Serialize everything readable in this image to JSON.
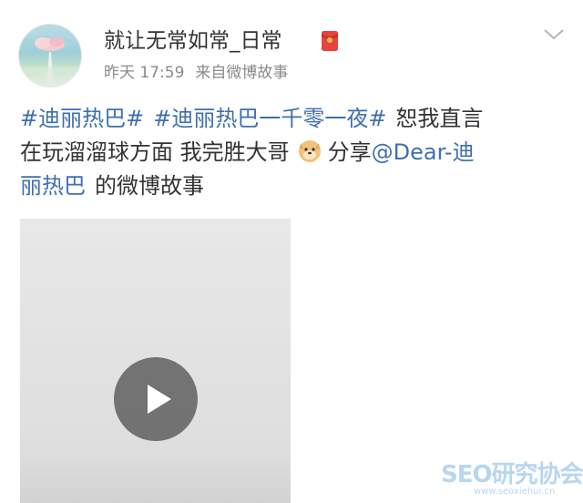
{
  "post": {
    "username": "就让无常如常_日常",
    "time": "昨天 17:59",
    "source": "来自微博故事",
    "text": {
      "topic1": "#迪丽热巴#",
      "topic2": "#迪丽热巴一千零一夜#",
      "line1_tail": "恕我直言",
      "line2_text": "在玩溜溜球方面 我完胜大哥",
      "share_label": "分享",
      "mention_part1": "@Dear-迪",
      "mention_part2": "丽热巴",
      "line3_tail": "的微博故事"
    }
  },
  "watermark": {
    "main": "SEO研究协会网",
    "sub": "www.seoxiehui.cn"
  },
  "colors": {
    "link": "#3f6fae",
    "text": "#333333",
    "meta": "#8a8a8a",
    "video_bg": "#e0e0e0"
  },
  "icons": [
    "red-packet-icon",
    "chevron-down-icon",
    "doge-emoji-icon",
    "play-icon"
  ]
}
